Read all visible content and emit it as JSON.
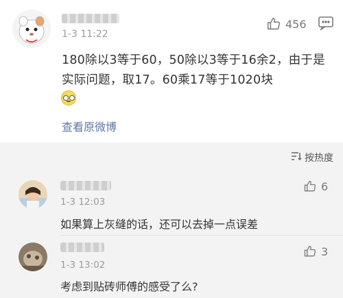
{
  "main_post": {
    "time": "1-3 11:22",
    "likes": "456",
    "text": "180除以3等于60，50除以3等于16余2，由于是实际问题，取17。60乘17等于1020块",
    "emoji_icon": "nerd-face-icon",
    "view_original": "查看原微博"
  },
  "sort": {
    "label": "按热度",
    "icon": "sort-icon"
  },
  "comments": [
    {
      "time": "1-3 12:03",
      "likes": "6",
      "text": "如果算上灰缝的话，还可以去掉一点误差"
    },
    {
      "time": "1-3 13:02",
      "likes": "3",
      "text": "考虑到贴砖师傅的感受了么?"
    }
  ]
}
